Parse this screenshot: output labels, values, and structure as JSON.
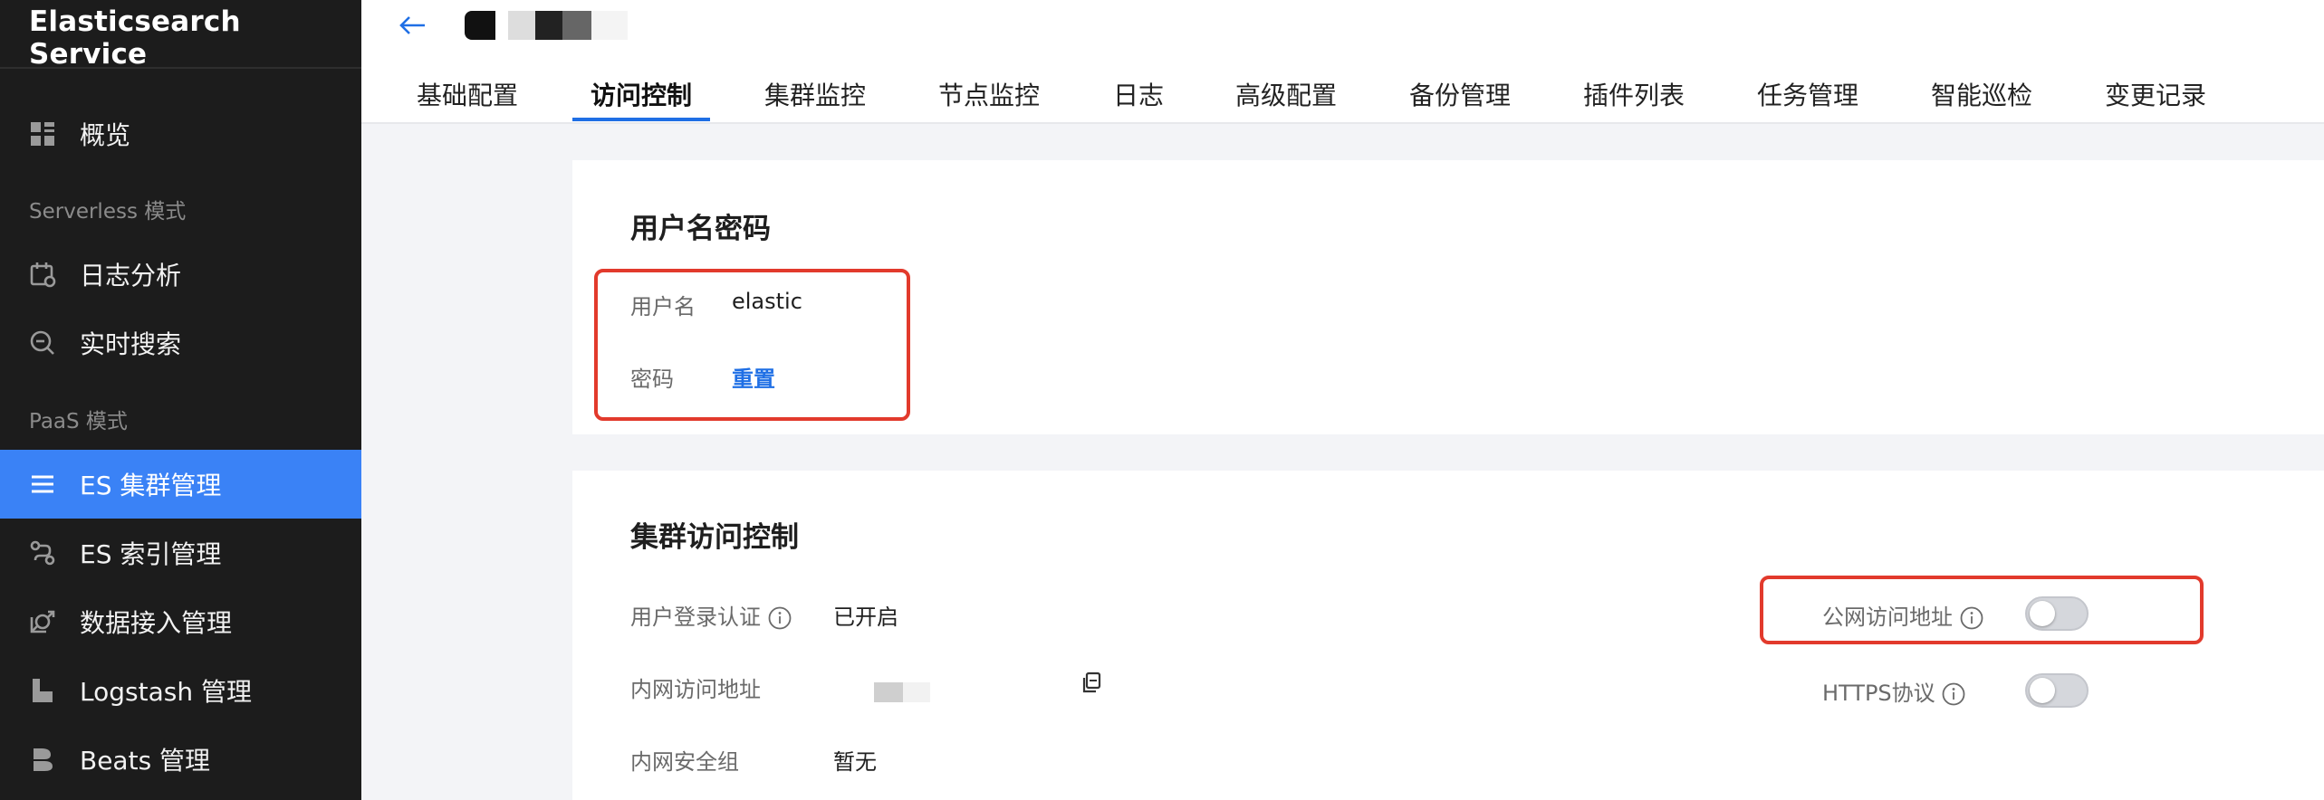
{
  "sidebar": {
    "brand": "Elasticsearch Service",
    "overview": "概览",
    "section_serverless": "Serverless 模式",
    "log_analysis": "日志分析",
    "realtime_search": "实时搜索",
    "section_paas": "PaaS 模式",
    "es_cluster": "ES 集群管理",
    "es_index": "ES 索引管理",
    "data_ingest": "数据接入管理",
    "logstash": "Logstash 管理",
    "beats": "Beats 管理"
  },
  "tabs": [
    "基础配置",
    "访问控制",
    "集群监控",
    "节点监控",
    "日志",
    "高级配置",
    "备份管理",
    "插件列表",
    "任务管理",
    "智能巡检",
    "变更记录"
  ],
  "active_tab": "访问控制",
  "user_password": {
    "title": "用户名密码",
    "username_label": "用户名",
    "username_value": "elastic",
    "password_label": "密码",
    "reset_link": "重置"
  },
  "cluster_access": {
    "title": "集群访问控制",
    "login_auth_label": "用户登录认证",
    "login_auth_value": "已开启",
    "intranet_addr_label": "内网访问地址",
    "intranet_sg_label": "内网安全组",
    "intranet_sg_value": "暂无",
    "public_addr_label": "公网访问地址",
    "public_addr_enabled": false,
    "https_label": "HTTPS协议",
    "https_enabled": false
  },
  "colors": {
    "sidebar_bg": "#1c1c1c",
    "active_nav": "#3a82f6",
    "link": "#1f6fe5",
    "highlight_box": "#e23a2c"
  }
}
